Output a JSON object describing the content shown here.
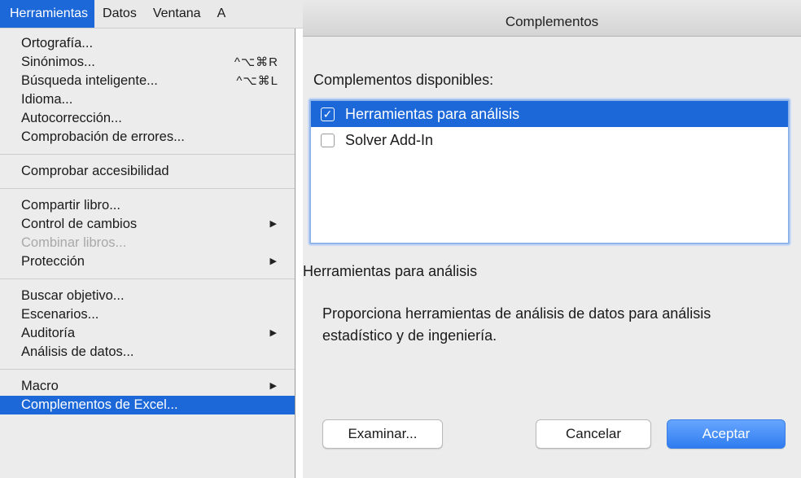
{
  "menubar": {
    "items": [
      {
        "label": "Herramientas"
      },
      {
        "label": "Datos"
      },
      {
        "label": "Ventana"
      },
      {
        "label": "A"
      }
    ]
  },
  "menu": {
    "items": [
      {
        "label": "Ortografía..."
      },
      {
        "label": "Sinónimos...",
        "shortcut": "^⌥⌘R"
      },
      {
        "label": "Búsqueda inteligente...",
        "shortcut": "^⌥⌘L"
      },
      {
        "label": "Idioma..."
      },
      {
        "label": "Autocorrección..."
      },
      {
        "label": "Comprobación de errores..."
      },
      {
        "label": "Comprobar accesibilidad"
      },
      {
        "label": "Compartir libro..."
      },
      {
        "label": "Control de cambios"
      },
      {
        "label": "Combinar libros..."
      },
      {
        "label": "Protección"
      },
      {
        "label": "Buscar objetivo..."
      },
      {
        "label": "Escenarios..."
      },
      {
        "label": "Auditoría"
      },
      {
        "label": "Análisis de datos..."
      },
      {
        "label": "Macro"
      },
      {
        "label": "Complementos de Excel..."
      }
    ]
  },
  "dialog": {
    "title": "Complementos",
    "available_label": "Complementos disponibles:",
    "addins": [
      {
        "label": "Herramientas para análisis",
        "checked": true,
        "check_glyph": "✓"
      },
      {
        "label": "Solver Add-In",
        "checked": false,
        "check_glyph": ""
      }
    ],
    "description_title": "Herramientas para análisis",
    "description": "Proporciona herramientas de análisis de datos para análisis estadístico y de ingeniería.",
    "buttons": {
      "browse": "Examinar...",
      "cancel": "Cancelar",
      "ok": "Aceptar"
    }
  },
  "colors": {
    "accent": "#1c68d8",
    "menu_bg": "#ececec",
    "dialog_bg": "#ececec"
  }
}
